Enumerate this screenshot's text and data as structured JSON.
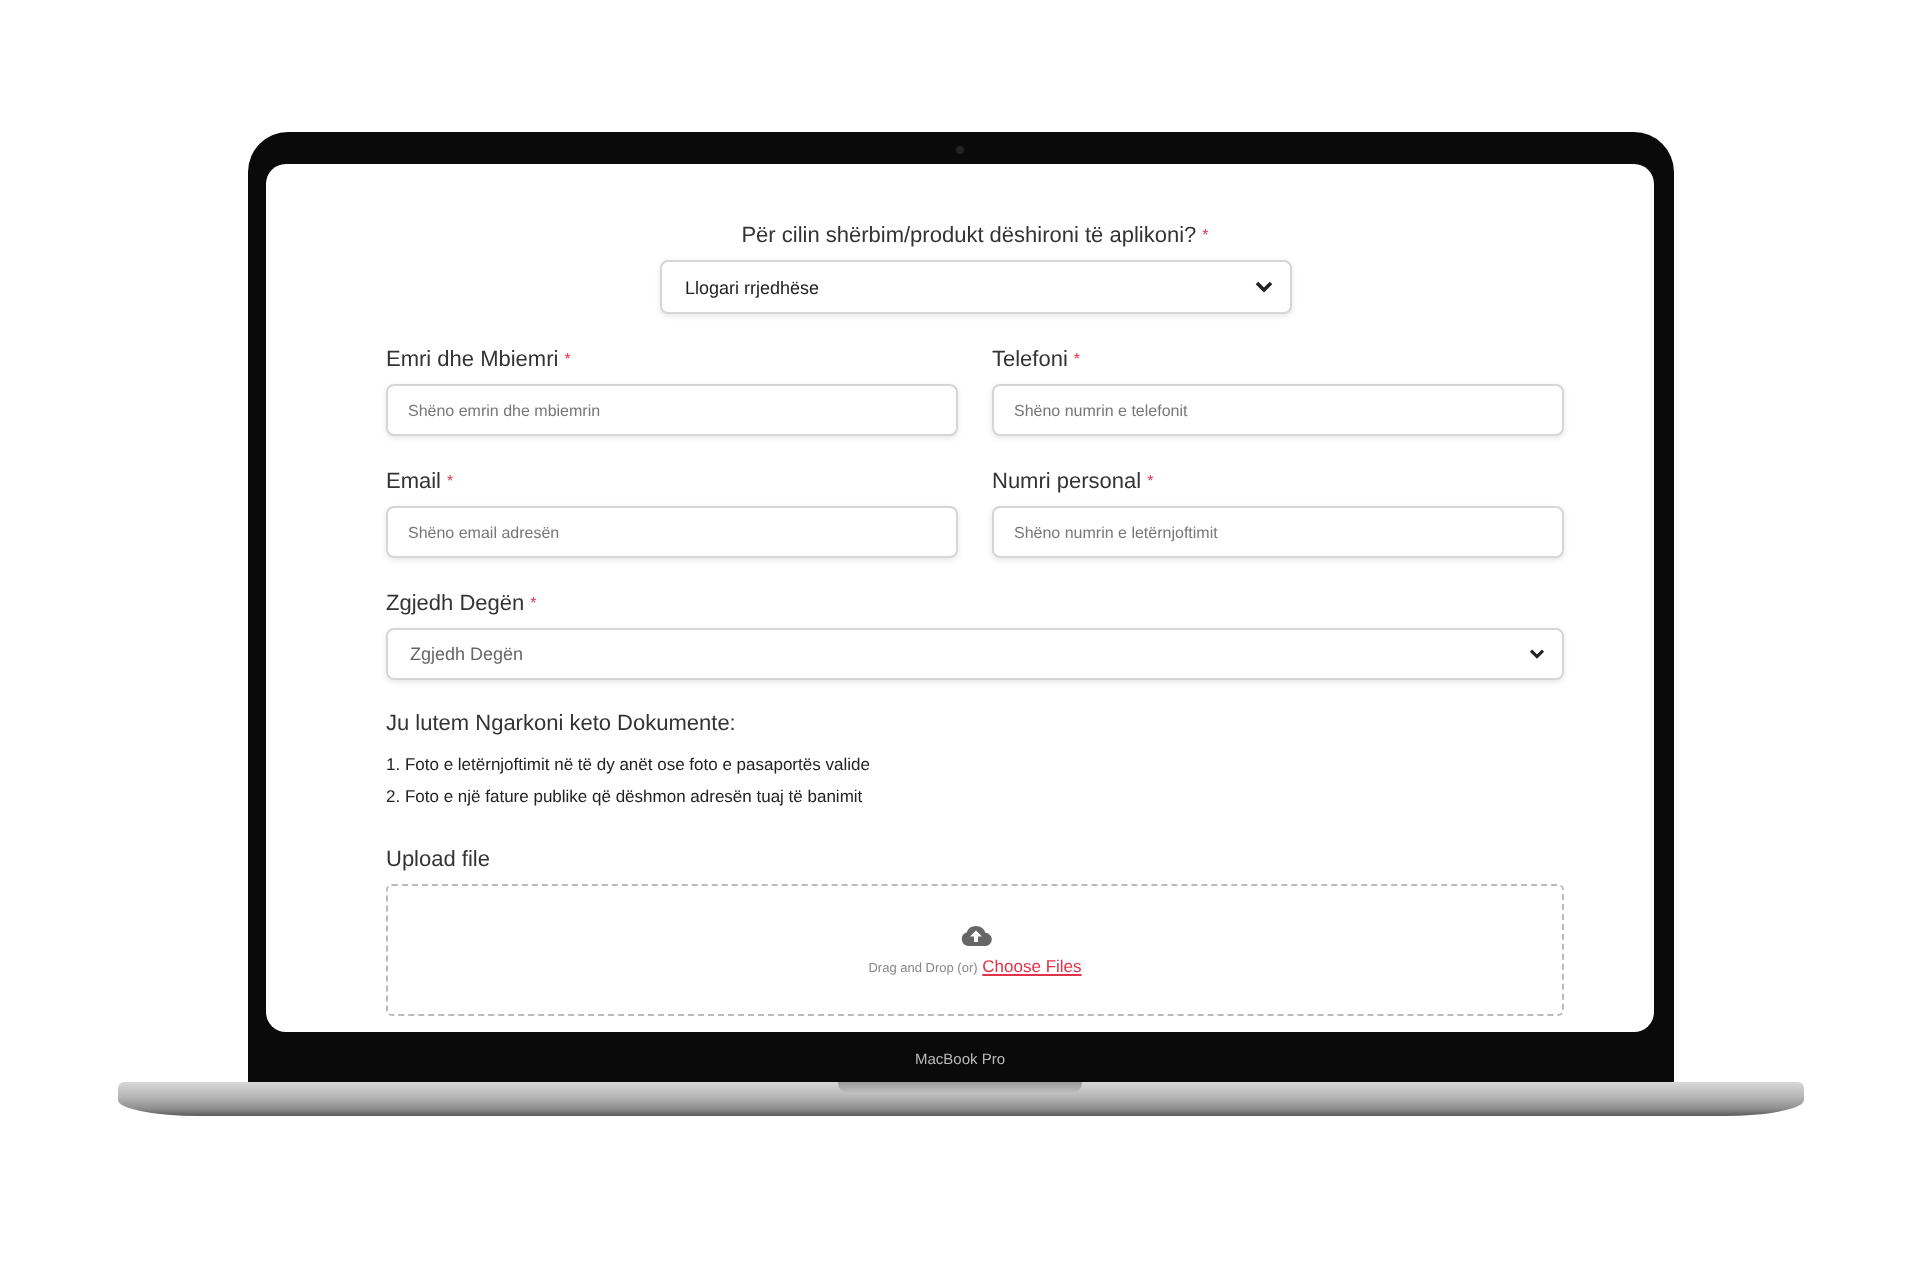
{
  "device_label": "MacBook Pro",
  "required_mark": "*",
  "service": {
    "label": "Për cilin shërbim/produkt dëshironi të aplikoni?",
    "required": true,
    "value": "Llogari rrjedhëse"
  },
  "fields": [
    {
      "label": "Emri dhe Mbiemri",
      "required": true,
      "placeholder": "Shëno emrin dhe mbiemrin"
    },
    {
      "label": "Telefoni",
      "required": true,
      "placeholder": "Shëno numrin e telefonit"
    },
    {
      "label": "Email",
      "required": true,
      "placeholder": "Shëno email adresën"
    },
    {
      "label": "Numri personal",
      "required": true,
      "placeholder": "Shëno numrin e letërnjoftimit"
    }
  ],
  "branch": {
    "label": "Zgjedh Degën",
    "required": true,
    "placeholder": "Zgjedh Degën"
  },
  "instructions": {
    "heading": "Ju lutem Ngarkoni keto Dokumente:",
    "items": [
      "1. Foto e letërnjoftimit në të dy anët ose foto e pasaportës valide",
      "2. Foto e një fature publike që dëshmon adresën tuaj të banimit"
    ]
  },
  "upload": {
    "label": "Upload file",
    "hint": "Drag and Drop (or)",
    "link": "Choose Files"
  }
}
